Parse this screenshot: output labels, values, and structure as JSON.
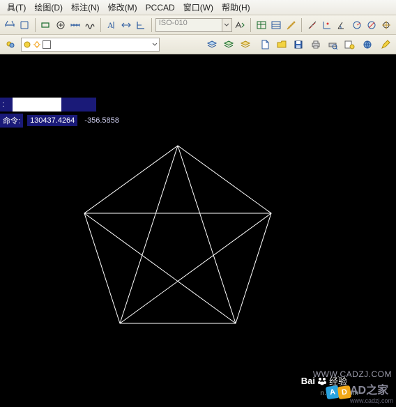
{
  "menu": {
    "tools": "具(T)",
    "draw": "绘图(D)",
    "annotate": "标注(N)",
    "modify": "修改(M)",
    "pccad": "PCCAD",
    "window": "窗口(W)",
    "help": "帮助(H)"
  },
  "toolbar1": {
    "dimstyle_box": "ISO-010"
  },
  "layerbar": {
    "layer_name": ""
  },
  "canvas": {
    "cmd_label": "命令:",
    "coord_x": "130437.4264",
    "coord_y": "-356.5858"
  },
  "watermark": {
    "right": "WWW.CADZJ.COM",
    "brand": "AD之家",
    "url": "www.cadzj.com",
    "baidu": "经验",
    "baidu_url": "n.baidu.com"
  },
  "icons": {
    "letterA": "A"
  }
}
